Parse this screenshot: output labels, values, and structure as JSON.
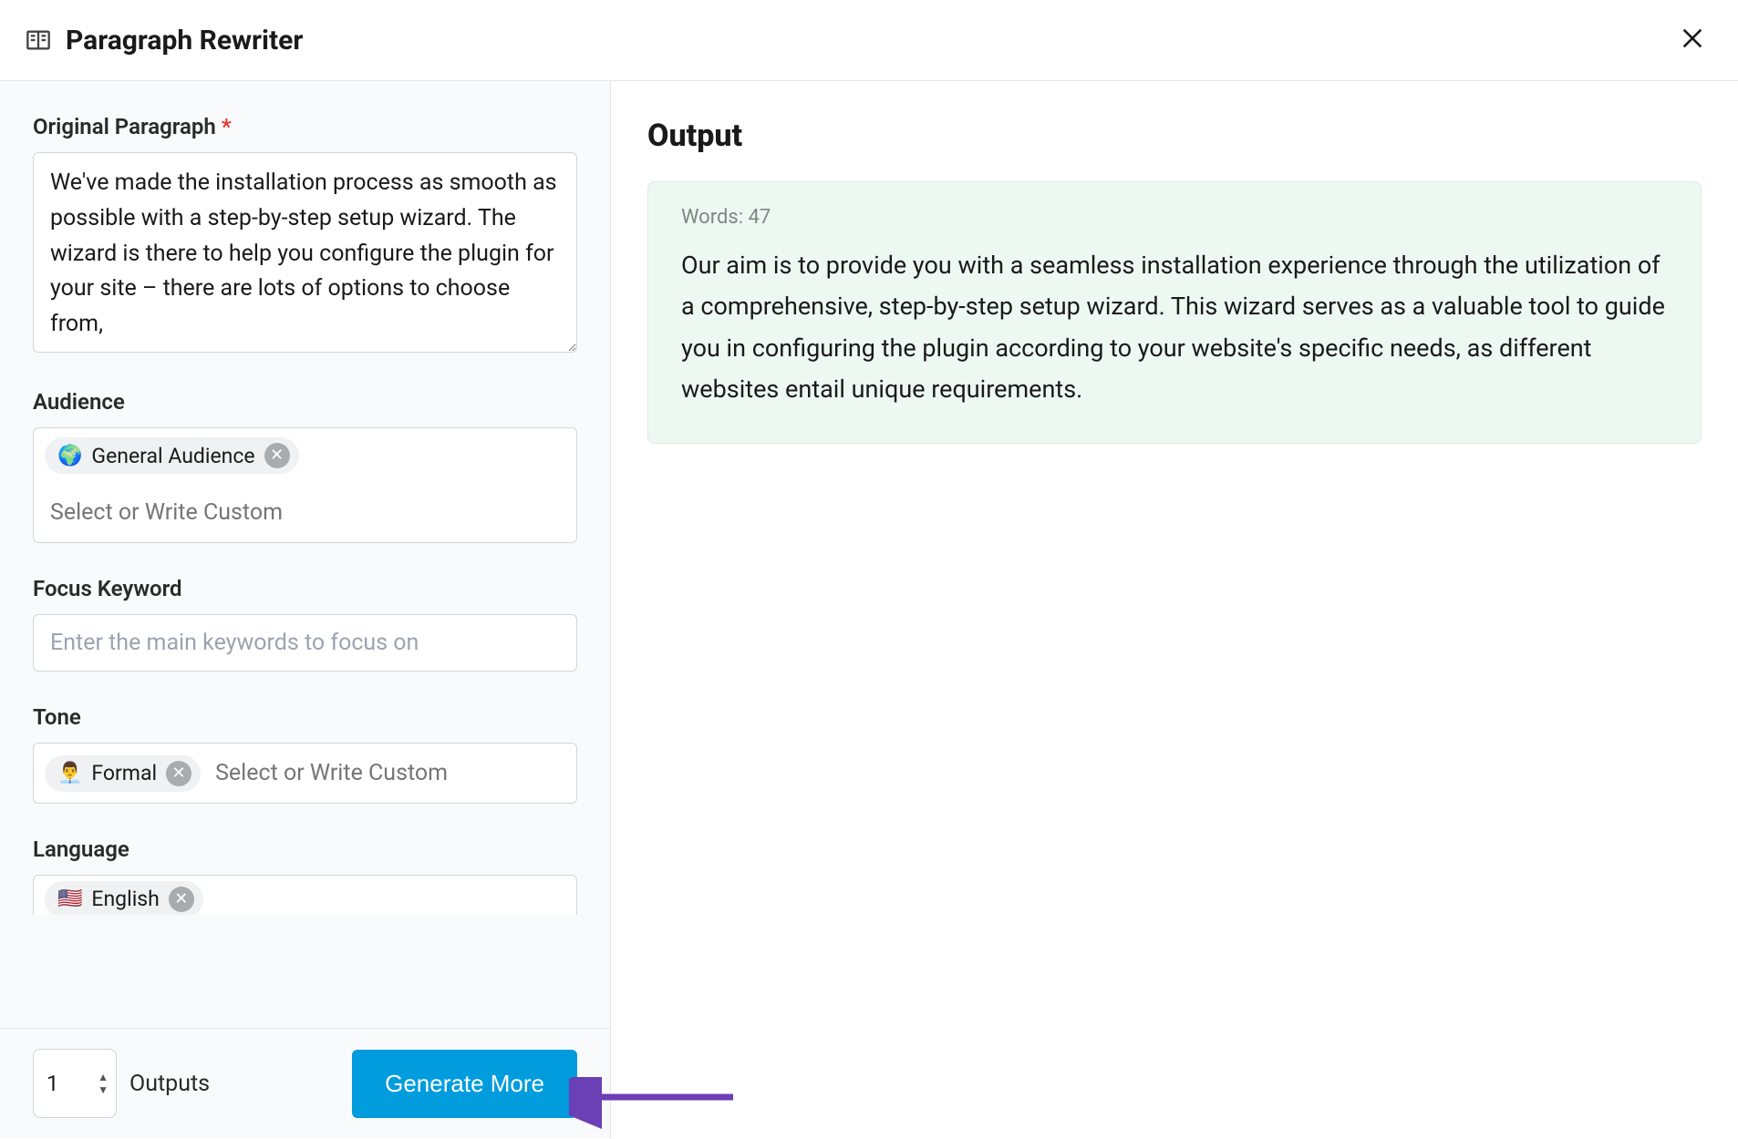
{
  "header": {
    "title": "Paragraph Rewriter"
  },
  "form": {
    "original_label": "Original Paragraph",
    "original_value": "We've made the installation process as smooth as possible with a step-by-step setup wizard. The wizard is there to help you configure the plugin for your site – there are lots of options to choose from,",
    "audience_label": "Audience",
    "audience_tag_emoji": "🌍",
    "audience_tag_text": "General Audience",
    "audience_placeholder": "Select or Write Custom",
    "focus_label": "Focus Keyword",
    "focus_placeholder": "Enter the main keywords to focus on",
    "tone_label": "Tone",
    "tone_tag_emoji": "👨‍💼",
    "tone_tag_text": "Formal",
    "tone_placeholder": "Select or Write Custom",
    "language_label": "Language",
    "language_tag_emoji": "🇺🇸",
    "language_tag_text": "English"
  },
  "bottom": {
    "count": "1",
    "outputs_label": "Outputs",
    "generate_label": "Generate More"
  },
  "output": {
    "title": "Output",
    "words_label": "Words: 47",
    "text": "Our aim is to provide you with a seamless installation experience through the utilization of a comprehensive, step-by-step setup wizard. This wizard serves as a valuable tool to guide you in configuring the plugin according to your website's specific needs, as different websites entail unique requirements."
  }
}
